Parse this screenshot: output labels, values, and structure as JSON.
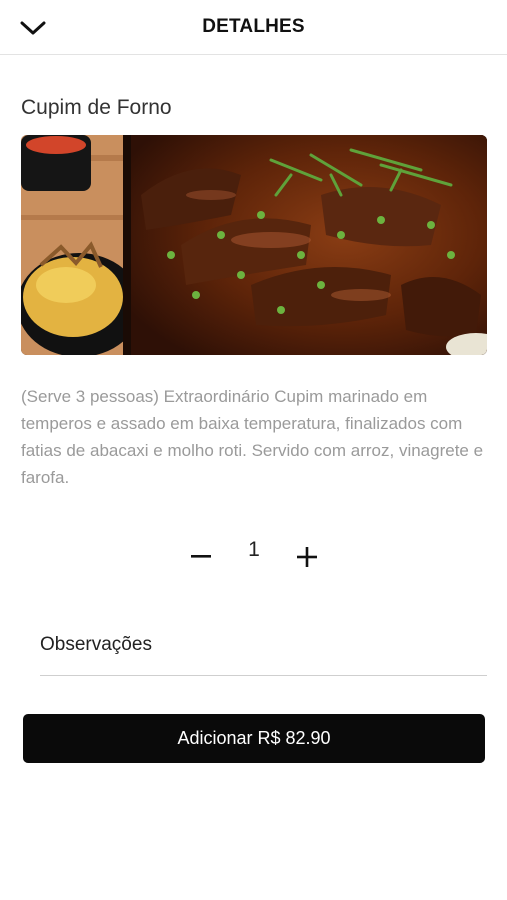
{
  "header": {
    "title": "DETALHES",
    "back_icon": "chevron-down-icon"
  },
  "product": {
    "name": "Cupim de Forno",
    "image_description": "food-photo",
    "description": "(Serve 3 pessoas) Extraordinário Cupim marinado em temperos e assado em baixa temperatura, finalizados com fatias de abacaxi e molho roti. Servido com arroz, vinagrete e farofa."
  },
  "quantity": {
    "minus_icon": "minus-icon",
    "value": "1",
    "plus_icon": "plus-icon"
  },
  "notes": {
    "placeholder": "Observações",
    "value": ""
  },
  "add_button": {
    "label": "Adicionar",
    "price": "R$ 82.90"
  },
  "colors": {
    "button_bg": "#0a0a0a",
    "description_text": "#9a9a9a",
    "divider": "#e3e3e3"
  }
}
